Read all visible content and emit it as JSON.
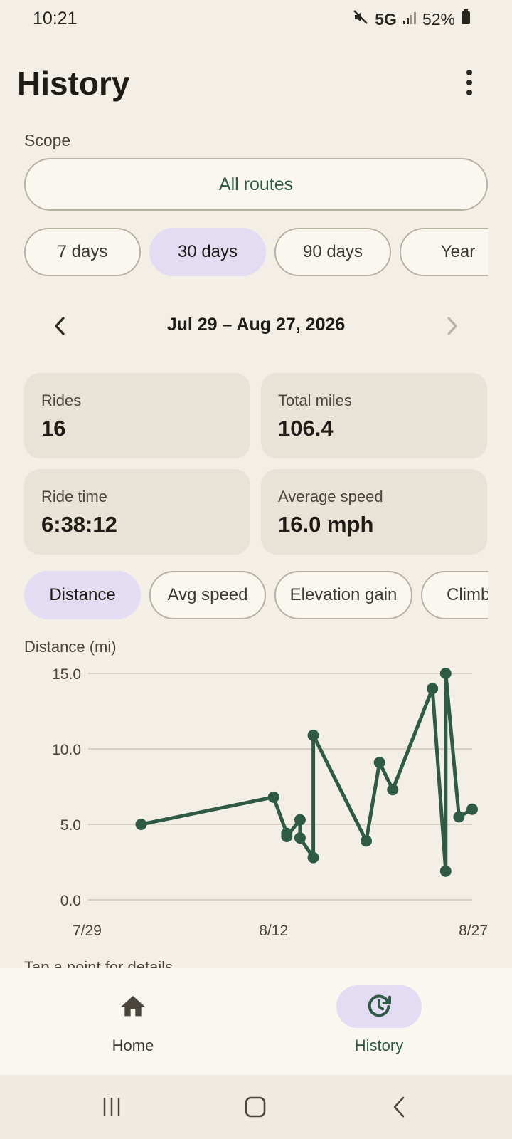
{
  "status_bar": {
    "time": "10:21",
    "network": "5G",
    "battery": "52%"
  },
  "header": {
    "title": "History"
  },
  "scope": {
    "label": "Scope",
    "value": "All routes"
  },
  "range_chips": [
    {
      "label": "7 days",
      "selected": false
    },
    {
      "label": "30 days",
      "selected": true
    },
    {
      "label": "90 days",
      "selected": false
    },
    {
      "label": "Year",
      "selected": false
    }
  ],
  "date_nav": {
    "range": "Jul 29 – Aug 27, 2026"
  },
  "stats": [
    {
      "label": "Rides",
      "value": "16"
    },
    {
      "label": "Total miles",
      "value": "106.4"
    },
    {
      "label": "Ride time",
      "value": "6:38:12"
    },
    {
      "label": "Average speed",
      "value": "16.0 mph"
    }
  ],
  "metric_chips": [
    {
      "label": "Distance",
      "selected": true
    },
    {
      "label": "Avg speed",
      "selected": false
    },
    {
      "label": "Elevation gain",
      "selected": false
    },
    {
      "label": "Climb",
      "selected": false
    }
  ],
  "chart_hint": "Tap a point for details",
  "chart_data": {
    "type": "line",
    "ylabel": "Distance (mi)",
    "ylim": [
      0,
      15
    ],
    "yticks": [
      "0.0",
      "5.0",
      "10.0",
      "15.0"
    ],
    "xticks": [
      {
        "label": "7/29",
        "day": 0
      },
      {
        "label": "8/12",
        "day": 14
      },
      {
        "label": "8/27",
        "day": 29
      }
    ],
    "grid": true,
    "color": "#2e5a46",
    "points": [
      {
        "day": 4.0,
        "value": 5.0
      },
      {
        "day": 14.0,
        "value": 6.8
      },
      {
        "day": 15.0,
        "value": 4.4
      },
      {
        "day": 15.0,
        "value": 4.2
      },
      {
        "day": 16.0,
        "value": 5.3
      },
      {
        "day": 16.0,
        "value": 4.1
      },
      {
        "day": 17.0,
        "value": 2.8
      },
      {
        "day": 17.0,
        "value": 10.9
      },
      {
        "day": 21.0,
        "value": 3.9
      },
      {
        "day": 22.0,
        "value": 9.1
      },
      {
        "day": 23.0,
        "value": 7.3
      },
      {
        "day": 26.0,
        "value": 14.0
      },
      {
        "day": 27.0,
        "value": 1.9
      },
      {
        "day": 27.0,
        "value": 15.0
      },
      {
        "day": 28.0,
        "value": 5.5
      },
      {
        "day": 29.0,
        "value": 6.0
      }
    ]
  },
  "bottom_nav": [
    {
      "label": "Home",
      "icon": "home-icon",
      "active": false
    },
    {
      "label": "History",
      "icon": "history-icon",
      "active": true
    }
  ],
  "colors": {
    "accent": "#2e5a46",
    "selected_chip": "#e4dcf3",
    "card": "#e8e2d7",
    "background": "#f3efe7"
  }
}
